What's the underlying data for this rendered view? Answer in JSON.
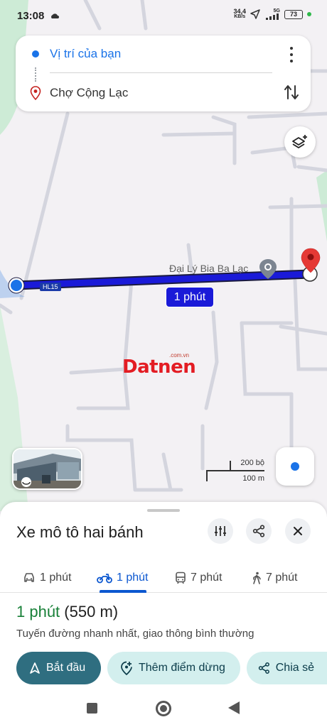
{
  "status_bar": {
    "time": "13:08",
    "net_speed": "34,4",
    "net_unit": "KB/s",
    "network": "5G",
    "battery": "73"
  },
  "route_card": {
    "origin": "Vị trí của bạn",
    "destination": "Chợ Cộng Lạc"
  },
  "map": {
    "poi_label": "Đại Lý Bia Ba Lạc",
    "route_chip": "1 phút",
    "road_label": "HL15",
    "watermark": "Datnen",
    "watermark_small": ".com.vn",
    "scale_top": "200 bộ",
    "scale_bottom": "100 m",
    "route_color": "#1a1ad8"
  },
  "sheet": {
    "title": "Xe mô tô hai bánh",
    "modes": [
      {
        "icon": "car-icon",
        "label": "1 phút"
      },
      {
        "icon": "motorbike-icon",
        "label": "1 phút"
      },
      {
        "icon": "transit-icon",
        "label": "7 phút"
      },
      {
        "icon": "walk-icon",
        "label": "7 phút"
      }
    ],
    "summary_time": "1 phút",
    "summary_distance": "(550 m)",
    "description": "Tuyến đường nhanh nhất, giao thông bình thường",
    "actions": {
      "start": "Bắt đầu",
      "add_stop": "Thêm điểm dừng",
      "share": "Chia sẻ"
    }
  },
  "colors": {
    "accent": "#0b57d0",
    "time_green": "#188038",
    "start_button": "#2f6e80"
  }
}
